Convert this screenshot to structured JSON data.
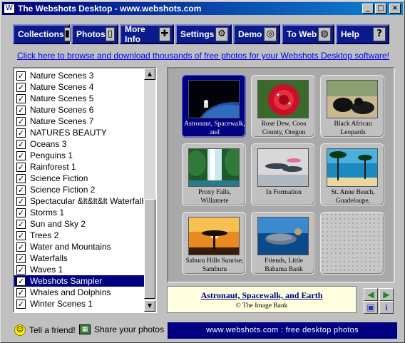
{
  "window": {
    "title": "The Webshots Desktop - www.webshots.com",
    "minimize_glyph": "_",
    "maximize_glyph": "□",
    "close_glyph": "×"
  },
  "toolbar": {
    "buttons": [
      {
        "label": "Collections",
        "icon": "book-icon",
        "glyph": "▮"
      },
      {
        "label": "Photos",
        "icon": "photo-icon",
        "glyph": "▯"
      },
      {
        "label": "More Info",
        "icon": "plus-icon",
        "glyph": "✚"
      },
      {
        "label": "Settings",
        "icon": "wrench-icon",
        "glyph": "⚙"
      },
      {
        "label": "Demo",
        "icon": "steering-wheel-icon",
        "glyph": "◎"
      },
      {
        "label": "To Web",
        "icon": "globe-icon",
        "glyph": "◍"
      },
      {
        "label": "Help",
        "icon": "question-icon",
        "glyph": "?"
      }
    ]
  },
  "banner_link": "Click here to browse and download thousands of free photos for your Webshots Desktop software!",
  "collections": {
    "check_glyph": "✓",
    "scroll_up_glyph": "▲",
    "scroll_down_glyph": "▼",
    "items": [
      {
        "label": "Nature Scenes 3",
        "checked": true,
        "selected": false
      },
      {
        "label": "Nature Scenes 4",
        "checked": true,
        "selected": false
      },
      {
        "label": "Nature Scenes 5",
        "checked": true,
        "selected": false
      },
      {
        "label": "Nature Scenes 6",
        "checked": true,
        "selected": false
      },
      {
        "label": "Nature Scenes 7",
        "checked": true,
        "selected": false
      },
      {
        "label": "NATURES BEAUTY",
        "checked": true,
        "selected": false
      },
      {
        "label": "Oceans 3",
        "checked": true,
        "selected": false
      },
      {
        "label": "Penguins 1",
        "checked": true,
        "selected": false
      },
      {
        "label": "Rainforest 1",
        "checked": true,
        "selected": false
      },
      {
        "label": "Science Fiction",
        "checked": true,
        "selected": false
      },
      {
        "label": "Science Fiction 2",
        "checked": true,
        "selected": false
      },
      {
        "label": "Spectacular &lt&lt&lt Waterfalls &gt&",
        "checked": true,
        "selected": false
      },
      {
        "label": "Storms 1",
        "checked": true,
        "selected": false
      },
      {
        "label": "Sun and Sky 2",
        "checked": true,
        "selected": false
      },
      {
        "label": "Trees 2",
        "checked": true,
        "selected": false
      },
      {
        "label": "Water and Mountains",
        "checked": true,
        "selected": false
      },
      {
        "label": "Waterfalls",
        "checked": true,
        "selected": false
      },
      {
        "label": "Waves 1",
        "checked": true,
        "selected": false
      },
      {
        "label": "Webshots Sampler",
        "checked": true,
        "selected": true
      },
      {
        "label": "Whales and Dolphins",
        "checked": true,
        "selected": false
      },
      {
        "label": "Winter Scenes 1",
        "checked": true,
        "selected": false
      }
    ]
  },
  "photos": [
    {
      "caption": "Astronaut, Spacewalk, and",
      "selected": true,
      "scene": "space"
    },
    {
      "caption": "Rose Dew, Coos County, Oregon",
      "selected": false,
      "scene": "rose"
    },
    {
      "caption": "Black African Leopards",
      "selected": false,
      "scene": "leopards"
    },
    {
      "caption": "Proxy Falls, Willamete",
      "selected": false,
      "scene": "falls"
    },
    {
      "caption": "In Formation",
      "selected": false,
      "scene": "dolphins"
    },
    {
      "caption": "St. Anne Beach, Guadeloupe,",
      "selected": false,
      "scene": "beach"
    },
    {
      "caption": "Saburu Hills Sunrise, Samburu",
      "selected": false,
      "scene": "savanna"
    },
    {
      "caption": "Friends, Little Bahama Bank",
      "selected": false,
      "scene": "underwater"
    },
    {
      "caption": "",
      "selected": false,
      "scene": "empty"
    }
  ],
  "photo_info": {
    "title": "Astronaut, Spacewalk, and Earth",
    "credit": "© The Image Bank"
  },
  "controls": {
    "prev_glyph": "◀",
    "next_glyph": "▶",
    "wallpaper_glyph": "▣",
    "info_glyph": "i"
  },
  "footer": {
    "tell_friend": "Tell a friend!",
    "share_photos": "Share your photos",
    "tagline": "www.webshots.com : free desktop photos",
    "smiley_glyph": "☺",
    "share_glyph": "▦"
  },
  "colors": {
    "title_bar": "#000080",
    "toolbar_button": "#0a1a8c",
    "selection": "#000080",
    "link": "#0000ee",
    "info_background": "#ffffe0"
  }
}
